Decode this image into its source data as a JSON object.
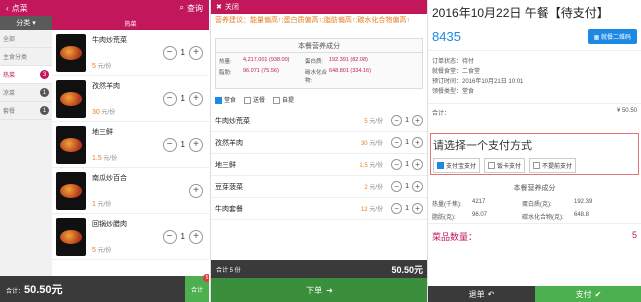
{
  "p1": {
    "back_label": "点菜",
    "search_label": "查询",
    "category_label": "分类",
    "hot_label": "热菜",
    "sidebar": [
      {
        "label": "全部",
        "badge": ""
      },
      {
        "label": "主食分类",
        "badge": ""
      },
      {
        "label": "热菜",
        "badge": "3"
      },
      {
        "label": "凉菜",
        "badge": "1"
      },
      {
        "label": "套餐",
        "badge": "1"
      }
    ],
    "dishes": [
      {
        "name": "牛肉炒荒菜",
        "price": "5",
        "unit": "元/份",
        "count": "1"
      },
      {
        "name": "孜然羊肉",
        "price": "30",
        "unit": "元/份",
        "count": "1"
      },
      {
        "name": "地三鲜",
        "price": "1.5",
        "unit": "元/份",
        "count": "1"
      },
      {
        "name": "南瓜炒百合",
        "price": "1",
        "unit": "元/份",
        "count": ""
      },
      {
        "name": "回锅炒腊肉",
        "price": "5",
        "unit": "元/份",
        "count": "1"
      }
    ],
    "total_label": "合计：",
    "total_value": "50.50元",
    "checkout_label": "合计",
    "checkout_badge": "5"
  },
  "p2": {
    "close_label": "关闭",
    "tip": "营养建议：能量偏高↑;蛋白质偏高↑;脂肪偏高↑;碳水化合物偏高↑",
    "nutrition_title": "本餐营养成分",
    "nutrition": [
      {
        "k": "热量:",
        "v": "4,217.001 (938.00)",
        "k2": "蛋白质:",
        "v2": "192.391 (82.08)"
      },
      {
        "k": "脂肪:",
        "v": "96.071 (75.56)",
        "k2": "碳水化合物:",
        "v2": "648.801 (334.16)"
      }
    ],
    "meal_opts": [
      "堂食",
      "送餐",
      "自提"
    ],
    "items": [
      {
        "name": "牛肉炒荒菜",
        "price": "5",
        "unit": "元/份",
        "count": "1"
      },
      {
        "name": "孜然羊肉",
        "price": "30",
        "unit": "元/份",
        "count": "1"
      },
      {
        "name": "地三鲜",
        "price": "1.5",
        "unit": "元/份",
        "count": "1"
      },
      {
        "name": "豆芽菠菜",
        "price": "2",
        "unit": "元/份",
        "count": "1"
      },
      {
        "name": "牛肉套餐",
        "price": "12",
        "unit": "元/份",
        "count": "1"
      }
    ],
    "total_label": "合计 5 份",
    "total_value": "50.50元",
    "order_label": "下单"
  },
  "p3": {
    "title": "2016年10月22日 午餐【待支付】",
    "order_no": "8435",
    "qr_label": "就餐二维码",
    "info": [
      "订单状态：待付",
      "就餐食堂：二食堂",
      "预订时间：2016年10月21日 10:01",
      "领餐类型：堂食"
    ],
    "sum_label": "合计：",
    "sum_value": "¥ 50.50",
    "pay_title": "请选择一个支付方式",
    "pay_opts": [
      "支付宝支付",
      "饭卡支付",
      "不提前支付"
    ],
    "nutrition_title": "本餐营养成分",
    "nutrition": [
      {
        "k": "热量(千焦):",
        "v": "4217",
        "k2": "蛋白质(克):",
        "v2": "192.39"
      },
      {
        "k": "脂肪(克):",
        "v": "96.07",
        "k2": "碳水化合物(克):",
        "v2": "648.8"
      }
    ],
    "cai_label": "菜品数量：",
    "cai_value": "5",
    "back_label": "退单",
    "pay_label": "支付"
  }
}
